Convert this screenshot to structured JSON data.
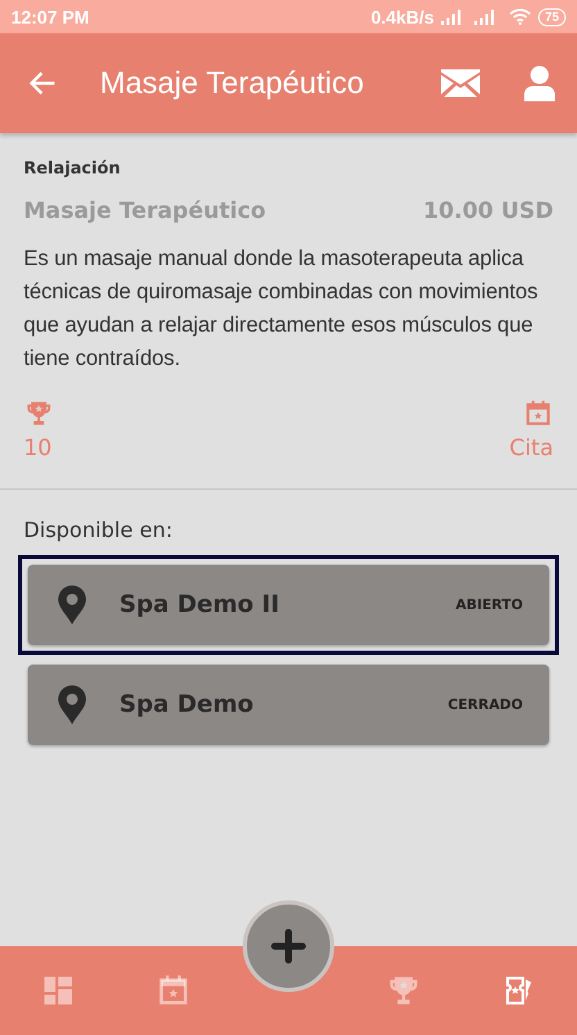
{
  "status_bar": {
    "time": "12:07 PM",
    "speed": "0.4kB/s",
    "battery": "75"
  },
  "app_bar": {
    "title": "Masaje Terapéutico"
  },
  "service": {
    "category": "Relajación",
    "name": "Masaje Terapéutico",
    "price": "10.00 USD",
    "description": "Es un masaje manual donde la masoterapeuta aplica técnicas de quiromasaje combinadas con movimientos que ayudan a relajar directamente esos músculos que tiene contraídos.",
    "points": "10",
    "appointment_label": "Cita"
  },
  "locations_heading": "Disponible en:",
  "locations": [
    {
      "name": "Spa Demo II",
      "status": "ABIERTO",
      "selected": true
    },
    {
      "name": "Spa Demo",
      "status": "CERRADO",
      "selected": false
    }
  ],
  "bottom_nav": [
    {
      "kind": "dashboard",
      "selected": false
    },
    {
      "kind": "calendar",
      "selected": false
    },
    {
      "kind": "trophy",
      "selected": false
    },
    {
      "kind": "tickets",
      "selected": true
    }
  ]
}
